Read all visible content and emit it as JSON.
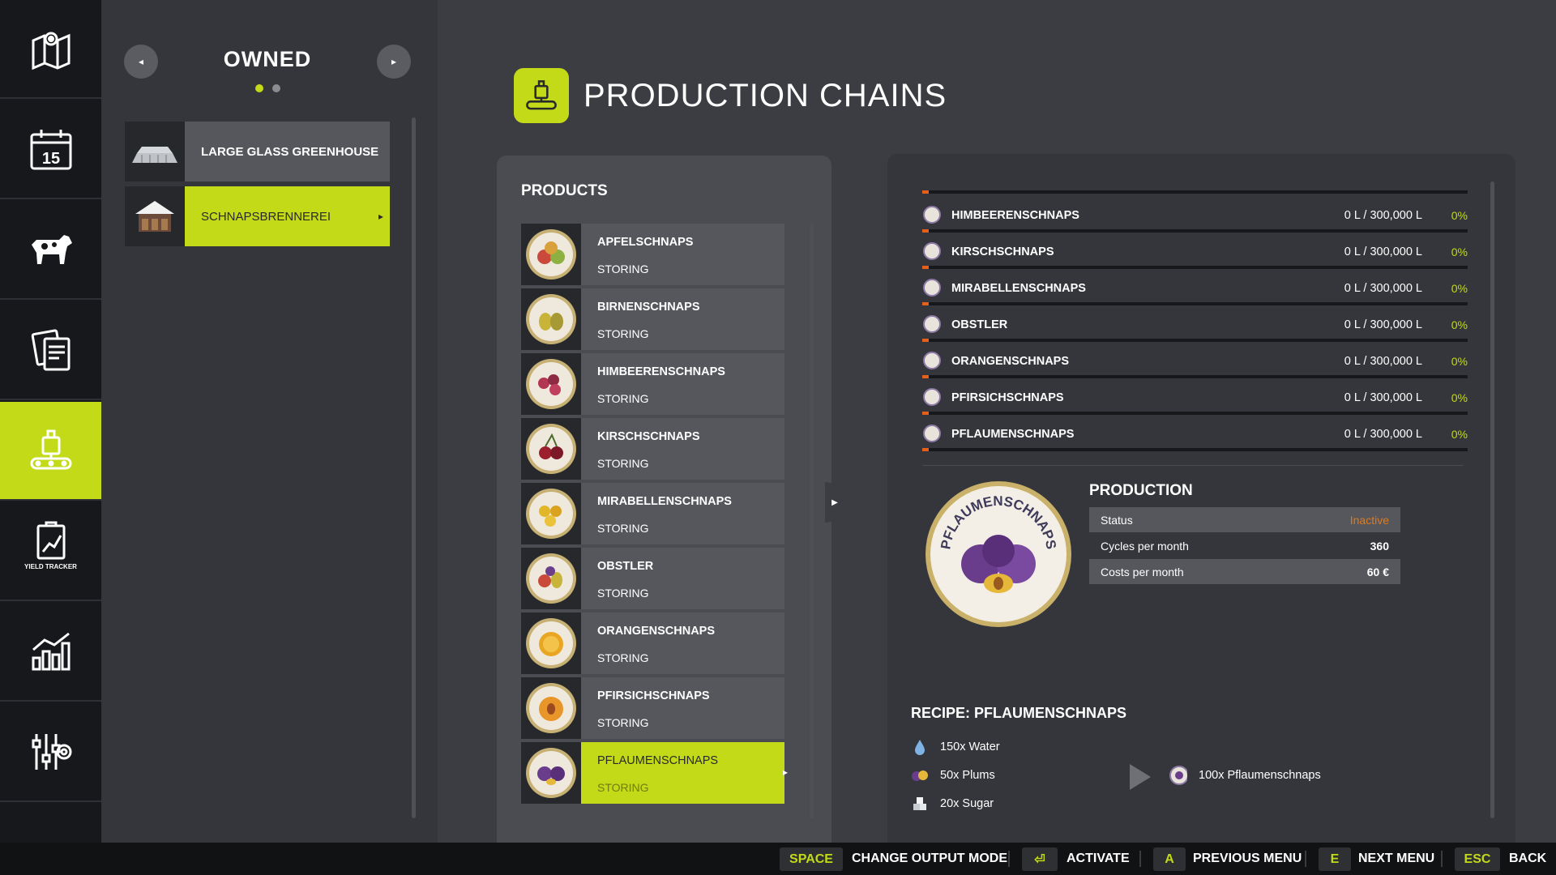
{
  "sidebar": {
    "items": [
      {
        "icon": "map-icon"
      },
      {
        "icon": "calendar-icon",
        "date": "15"
      },
      {
        "icon": "animals-icon"
      },
      {
        "icon": "contracts-icon"
      },
      {
        "icon": "production-icon",
        "active": true
      },
      {
        "icon": "yield-tracker-icon",
        "label": "YIELD TRACKER"
      },
      {
        "icon": "statistics-icon"
      },
      {
        "icon": "settings-icon"
      }
    ]
  },
  "owned": {
    "title": "OWNED",
    "prev_icon": "◂",
    "next_icon": "▸",
    "items": [
      {
        "label": "LARGE GLASS GREENHOUSE",
        "active": false
      },
      {
        "label": "SCHNAPSBRENNEREI",
        "active": true
      }
    ]
  },
  "header": {
    "title": "PRODUCTION CHAINS"
  },
  "products": {
    "title": "PRODUCTS",
    "items": [
      {
        "name": "APFELSCHNAPS",
        "state": "STORING"
      },
      {
        "name": "BIRNENSCHNAPS",
        "state": "STORING"
      },
      {
        "name": "HIMBEERENSCHNAPS",
        "state": "STORING"
      },
      {
        "name": "KIRSCHSCHNAPS",
        "state": "STORING"
      },
      {
        "name": "MIRABELLENSCHNAPS",
        "state": "STORING"
      },
      {
        "name": "OBSTLER",
        "state": "STORING"
      },
      {
        "name": "ORANGENSCHNAPS",
        "state": "STORING"
      },
      {
        "name": "PFIRSICHSCHNAPS",
        "state": "STORING"
      },
      {
        "name": "PFLAUMENSCHNAPS",
        "state": "STORING",
        "active": true
      }
    ]
  },
  "storage": {
    "rows": [
      {
        "name": "HIMBEERENSCHNAPS",
        "value": "0 L / 300,000 L",
        "pct": "0%"
      },
      {
        "name": "KIRSCHSCHNAPS",
        "value": "0 L / 300,000 L",
        "pct": "0%"
      },
      {
        "name": "MIRABELLENSCHNAPS",
        "value": "0 L / 300,000 L",
        "pct": "0%"
      },
      {
        "name": "OBSTLER",
        "value": "0 L / 300,000 L",
        "pct": "0%"
      },
      {
        "name": "ORANGENSCHNAPS",
        "value": "0 L / 300,000 L",
        "pct": "0%"
      },
      {
        "name": "PFIRSICHSCHNAPS",
        "value": "0 L / 300,000 L",
        "pct": "0%"
      },
      {
        "name": "PFLAUMENSCHNAPS",
        "value": "0 L / 300,000 L",
        "pct": "0%"
      }
    ]
  },
  "production": {
    "title": "PRODUCTION",
    "badge_text": "PFLAUMENSCHNAPS",
    "status_label": "Status",
    "status_value": "Inactive",
    "cycles_label": "Cycles per month",
    "cycles_value": "360",
    "costs_label": "Costs per month",
    "costs_value": "60 €"
  },
  "recipe": {
    "title": "RECIPE: PFLAUMENSCHNAPS",
    "inputs": [
      {
        "icon": "water-drop-icon",
        "text": "150x Water"
      },
      {
        "icon": "plums-icon",
        "text": "50x Plums"
      },
      {
        "icon": "sugar-icon",
        "text": "20x Sugar"
      }
    ],
    "output": {
      "icon": "pflaumenschnaps-icon",
      "text": "100x Pflaumenschnaps"
    }
  },
  "bottom": {
    "actions": [
      {
        "key": "SPACE",
        "label": "CHANGE OUTPUT MODE"
      },
      {
        "key": "⏎",
        "label": "ACTIVATE"
      },
      {
        "key": "A",
        "label": "PREVIOUS MENU"
      },
      {
        "key": "E",
        "label": "NEXT MENU"
      },
      {
        "key": "ESC",
        "label": "BACK"
      }
    ]
  },
  "colors": {
    "accent": "#c3da19",
    "inactive": "#e07a1a",
    "sidebar": "#17181b",
    "panel": "#34363b"
  }
}
